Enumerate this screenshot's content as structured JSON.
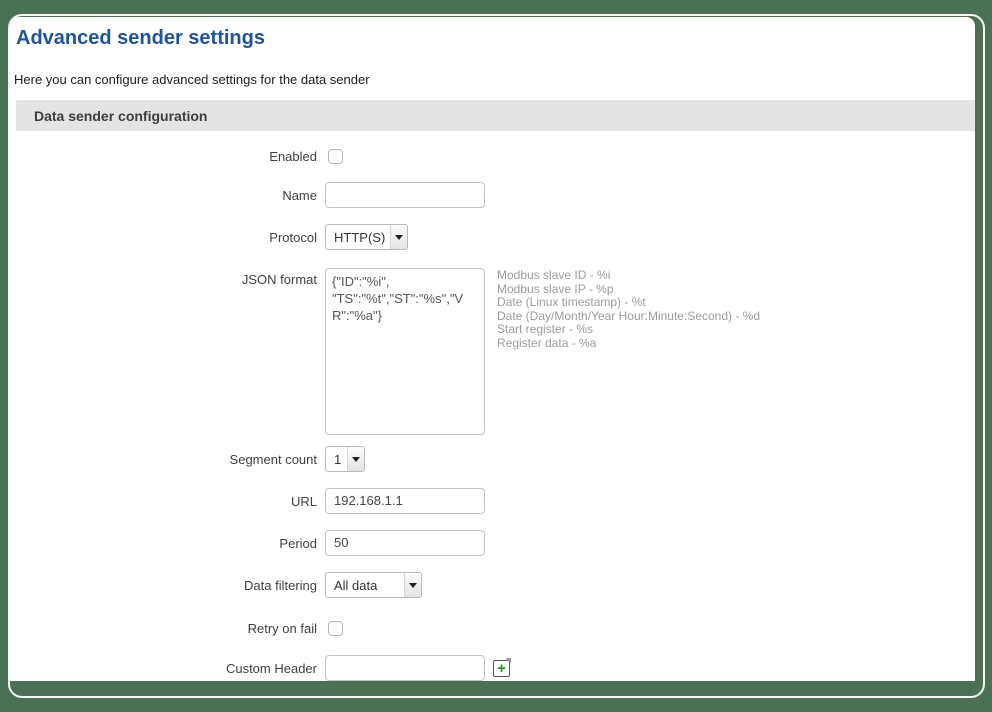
{
  "page": {
    "title": "Advanced sender settings",
    "subtitle": "Here you can configure advanced settings for the data sender"
  },
  "section": {
    "title": "Data sender configuration"
  },
  "form": {
    "enabled": {
      "label": "Enabled",
      "checked": false
    },
    "name": {
      "label": "Name",
      "value": ""
    },
    "protocol": {
      "label": "Protocol",
      "value": "HTTP(S)"
    },
    "json_format": {
      "label": "JSON format",
      "value": "{\"ID\":\"%i\",\n\"TS\":\"%t\",\"ST\":\"%s\",\"VR\":\"%a\"}",
      "hints": [
        "Modbus slave ID - %i",
        "Modbus slave IP - %p",
        "Date (Linux timestamp) - %t",
        "Date (Day/Month/Year Hour:Minute:Second) - %d",
        "Start register - %s",
        "Register data - %a"
      ]
    },
    "segment_count": {
      "label": "Segment count",
      "value": "1"
    },
    "url": {
      "label": "URL",
      "value": "192.168.1.1"
    },
    "period": {
      "label": "Period",
      "value": "50"
    },
    "data_filtering": {
      "label": "Data filtering",
      "value": "All data"
    },
    "retry_on_fail": {
      "label": "Retry on fail",
      "checked": false
    },
    "custom_header": {
      "label": "Custom Header",
      "value": "",
      "add_icon": "add-icon"
    }
  },
  "colors": {
    "background_green": "#4a7153",
    "title_blue": "#1d53a3",
    "section_bar_gray": "#e4e4e4",
    "hint_gray": "#9b9b9b",
    "add_plus_green": "#1e8e1e"
  }
}
